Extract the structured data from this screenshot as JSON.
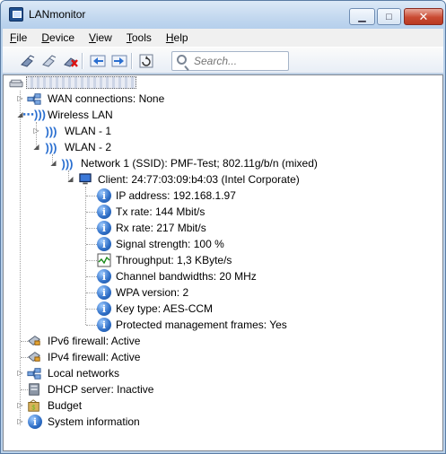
{
  "window": {
    "title": "LANmonitor"
  },
  "menu": [
    "File",
    "Device",
    "View",
    "Tools",
    "Help"
  ],
  "toolbar": {
    "search_placeholder": "Search..."
  },
  "tree": {
    "root_label": "",
    "items": [
      {
        "label": "WAN connections: None"
      },
      {
        "label": "Wireless LAN"
      },
      {
        "label": "WLAN - 1"
      },
      {
        "label": "WLAN - 2"
      },
      {
        "label": "Network 1 (SSID): PMF-Test; 802.11g/b/n (mixed)"
      },
      {
        "label": "Client: 24:77:03:09:b4:03 (Intel Corporate)"
      },
      {
        "label": "IP address: 192.168.1.97"
      },
      {
        "label": "Tx rate: 144 Mbit/s"
      },
      {
        "label": "Rx rate: 217 Mbit/s"
      },
      {
        "label": "Signal strength: 100 %"
      },
      {
        "label": "Throughput: 1,3 KByte/s"
      },
      {
        "label": "Channel bandwidths: 20 MHz"
      },
      {
        "label": "WPA version: 2"
      },
      {
        "label": "Key type: AES-CCM"
      },
      {
        "label": "Protected management frames: Yes"
      },
      {
        "label": "IPv6 firewall: Active"
      },
      {
        "label": "IPv4 firewall: Active"
      },
      {
        "label": "Local networks"
      },
      {
        "label": "DHCP server: Inactive"
      },
      {
        "label": "Budget"
      },
      {
        "label": "System information"
      }
    ]
  }
}
